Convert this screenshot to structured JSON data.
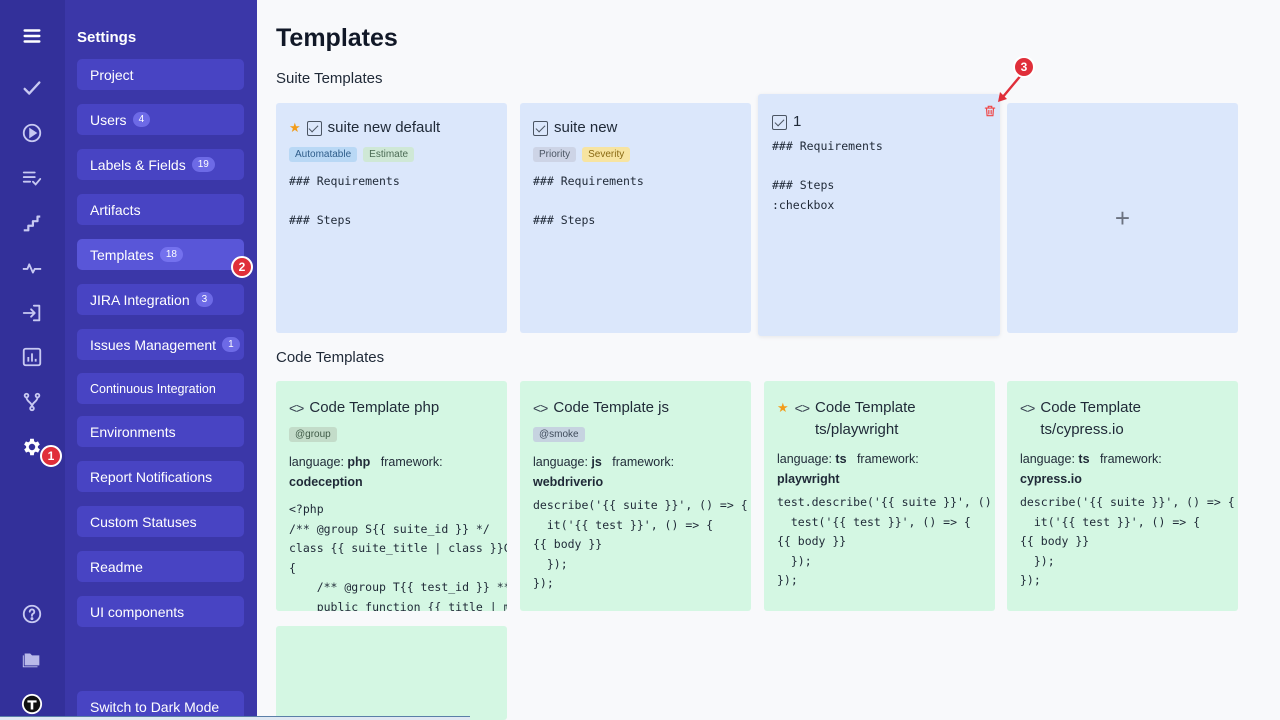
{
  "sidebar": {
    "title": "Settings",
    "items": [
      {
        "label": "Project",
        "count": ""
      },
      {
        "label": "Users",
        "count": "4"
      },
      {
        "label": "Labels & Fields",
        "count": "19"
      },
      {
        "label": "Artifacts",
        "count": ""
      },
      {
        "label": "Templates",
        "count": "18"
      },
      {
        "label": "JIRA Integration",
        "count": "3"
      },
      {
        "label": "Issues Management",
        "count": "1"
      },
      {
        "label": "Continuous Integration",
        "count": ""
      },
      {
        "label": "Environments",
        "count": ""
      },
      {
        "label": "Report Notifications",
        "count": ""
      },
      {
        "label": "Custom Statuses",
        "count": ""
      },
      {
        "label": "Readme",
        "count": ""
      },
      {
        "label": "UI components",
        "count": ""
      },
      {
        "label": "Switch to Dark Mode",
        "count": ""
      }
    ]
  },
  "rail": {
    "icons": [
      "menu-icon",
      "check-icon",
      "play-circle-icon",
      "checklist-icon",
      "stairs-icon",
      "pulse-icon",
      "import-icon",
      "bar-chart-icon",
      "branch-icon",
      "gear-icon",
      "help-icon",
      "folder-icon",
      "avatar"
    ]
  },
  "markers": [
    "1",
    "2",
    "3"
  ],
  "page": {
    "title": "Templates"
  },
  "suite_section": {
    "title": "Suite Templates"
  },
  "code_section": {
    "title": "Code Templates"
  },
  "suite_cards": [
    {
      "starred": true,
      "title": "suite new default",
      "tags": [
        "Automatable",
        "Estimate"
      ],
      "body": "### Requirements\n\n### Steps"
    },
    {
      "starred": false,
      "title": "suite new",
      "tags": [
        "Priority",
        "Severity"
      ],
      "body": "### Requirements\n\n### Steps"
    },
    {
      "starred": false,
      "title": "1",
      "tags": [],
      "body": "### Requirements\n\n### Steps\n:checkbox"
    }
  ],
  "code_cards": [
    {
      "starred": false,
      "title": "Code Template php",
      "tag": "@group",
      "language": "php",
      "framework": "codeception",
      "body": "<?php\n/** @group S{{ suite_id }} */\nclass {{ suite_title | class }}Cest\n{\n    /** @group T{{ test_id }} **/\n    public function {{ title | method }}"
    },
    {
      "starred": false,
      "title": "Code Template js",
      "tag": "@smoke",
      "language": "js",
      "framework": "webdriverio",
      "body": "describe('{{ suite }}', () => {\n  it('{{ test }}', () => {\n{{ body }}\n  });\n});"
    },
    {
      "starred": true,
      "title": "Code Template ts/playwright",
      "tag": "",
      "language": "ts",
      "framework": "playwright",
      "body": "test.describe('{{ suite }}', () => {\n  test('{{ test }}', () => {\n{{ body }}\n  });\n});"
    },
    {
      "starred": false,
      "title": "Code Template ts/cypress.io",
      "tag": "",
      "language": "ts",
      "framework": "cypress.io",
      "body": "describe('{{ suite }}', () => {\n  it('{{ test }}', () => {\n{{ body }}\n  });\n});"
    }
  ],
  "labels": {
    "language": "language:",
    "framework": "framework:",
    "add": "+"
  },
  "colors": {
    "rail": "#33309a",
    "sidebar": "#3b37a8",
    "nav_item": "#4844c3",
    "suite_card": "#dbe7fb",
    "code_card": "#d4f7e3",
    "marker": "#e02f3a"
  }
}
